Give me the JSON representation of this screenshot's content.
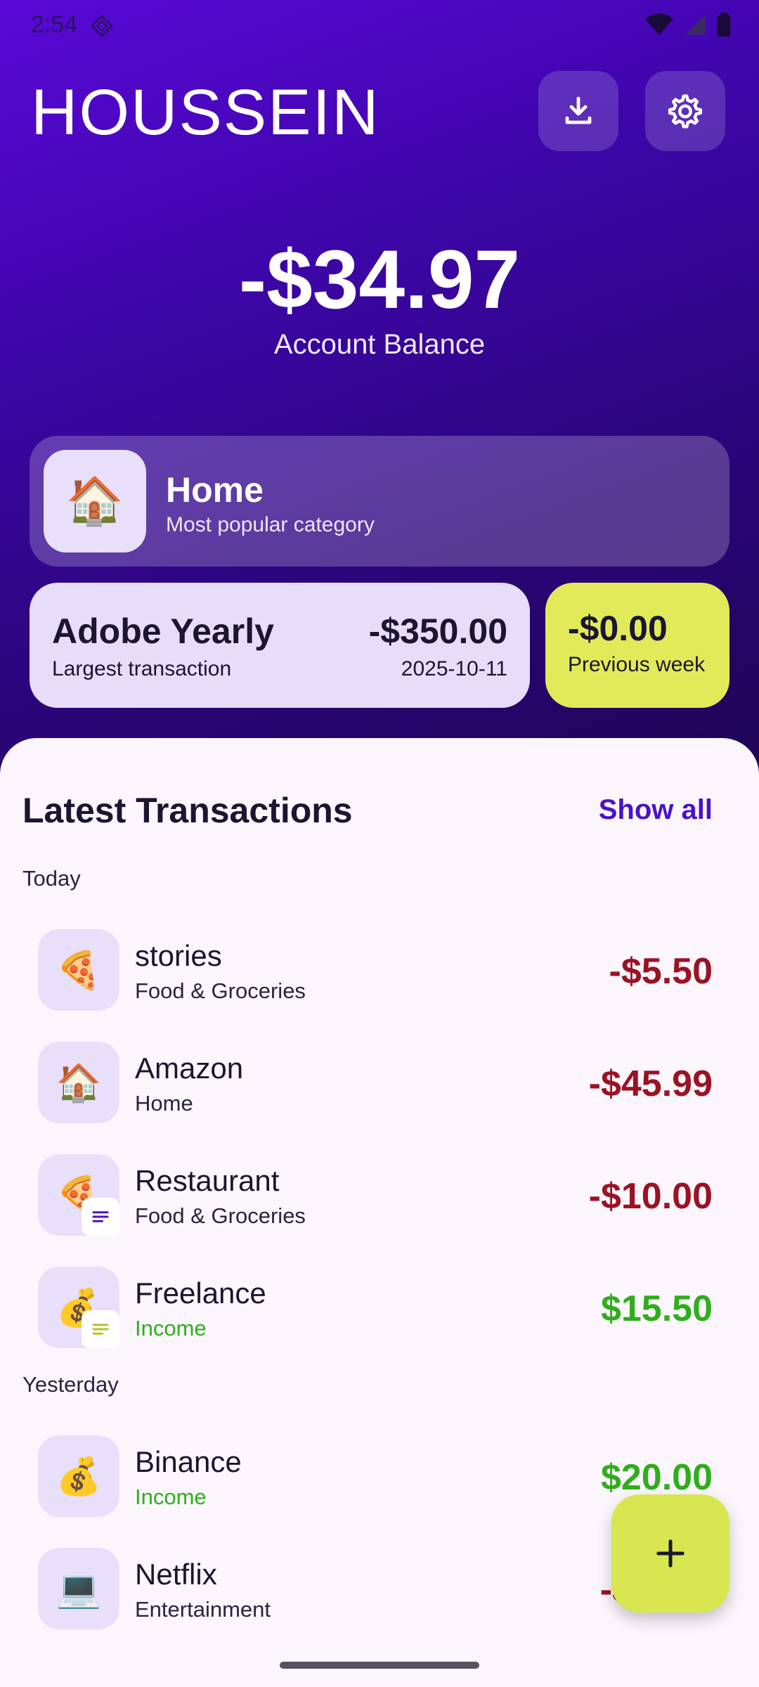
{
  "status_bar": {
    "time": "2:54"
  },
  "header": {
    "title": "HOUSSEIN"
  },
  "balance": {
    "amount": "-$34.97",
    "label": "Account Balance"
  },
  "popular_category": {
    "icon": "🏠",
    "name": "Home",
    "subtitle": "Most popular category"
  },
  "largest_transaction": {
    "name": "Adobe Yearly",
    "amount": "-$350.00",
    "label": "Largest transaction",
    "date": "2025-10-11"
  },
  "previous_week": {
    "amount": "-$0.00",
    "label": "Previous week"
  },
  "transactions": {
    "title": "Latest Transactions",
    "show_all": "Show all",
    "groups": [
      {
        "label": "Today",
        "items": [
          {
            "icon": "🍕",
            "name": "stories",
            "category": "Food & Groceries",
            "amount": "-$5.50"
          },
          {
            "icon": "🏠",
            "name": "Amazon",
            "category": "Home",
            "amount": "-$45.99"
          },
          {
            "icon": "🍕",
            "name": "Restaurant",
            "category": "Food & Groceries",
            "amount": "-$10.00"
          },
          {
            "icon": "💰",
            "name": "Freelance",
            "category": "Income",
            "amount": "$15.50"
          }
        ]
      },
      {
        "label": "Yesterday",
        "items": [
          {
            "icon": "💰",
            "name": "Binance",
            "category": "Income",
            "amount": "$20.00"
          },
          {
            "icon": "💻",
            "name": "Netflix",
            "category": "Entertainment",
            "amount": "-$"
          }
        ]
      }
    ]
  },
  "colors": {
    "accent": "#4a12c8",
    "negative": "#9b1225",
    "positive": "#2fae1c",
    "fab": "#d8e64f"
  }
}
